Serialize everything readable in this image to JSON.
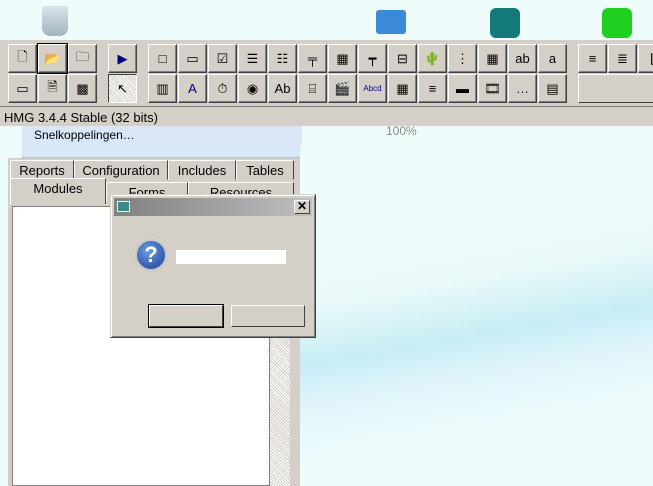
{
  "desktop": {
    "icons": [
      "recycle-bin-icon",
      "control-panel-icon",
      "shortcut-teal-cube-icon",
      "shortcut-green-cube-icon"
    ]
  },
  "toolbar": {
    "row1": [
      {
        "icon": "new-file-icon",
        "glyph": "🗋"
      },
      {
        "icon": "open-folder-icon",
        "glyph": "📂",
        "active": true
      },
      {
        "icon": "open-project-icon",
        "glyph": "🗀"
      },
      {
        "icon": "run-icon",
        "glyph": "▶"
      },
      {
        "icon": "frame-icon",
        "glyph": "□"
      },
      {
        "icon": "button-control-icon",
        "glyph": "▭"
      },
      {
        "icon": "checkbox-icon",
        "glyph": "☑"
      },
      {
        "icon": "listbox-icon",
        "glyph": "☰"
      },
      {
        "icon": "combobox-icon",
        "glyph": "☷"
      },
      {
        "icon": "splitter-icon",
        "glyph": "╤"
      },
      {
        "icon": "grid-icon",
        "glyph": "▦"
      },
      {
        "icon": "slider-icon",
        "glyph": "┯"
      },
      {
        "icon": "spinner-icon",
        "glyph": "⊟"
      },
      {
        "icon": "image-icon",
        "glyph": "🌵"
      },
      {
        "icon": "tree-icon",
        "glyph": "⋮"
      },
      {
        "icon": "datepicker-icon",
        "glyph": "▦"
      },
      {
        "icon": "textbox-icon",
        "glyph": "ab"
      },
      {
        "icon": "editbox-icon",
        "glyph": "a"
      },
      {
        "icon": "toolbar-control-icon",
        "glyph": "≡"
      },
      {
        "icon": "statusbar-icon",
        "glyph": "≣"
      },
      {
        "icon": "chart-icon",
        "glyph": "⌊"
      }
    ],
    "row2": [
      {
        "icon": "form-icon",
        "glyph": "▭"
      },
      {
        "icon": "document-icon",
        "glyph": "🗎"
      },
      {
        "icon": "texture-icon",
        "glyph": "▩"
      },
      {
        "icon": "pointer-icon",
        "glyph": "↖",
        "pressed": true
      },
      {
        "icon": "activex-icon",
        "glyph": "▥"
      },
      {
        "icon": "label-icon",
        "glyph": "A"
      },
      {
        "icon": "timer-icon",
        "glyph": "⏱"
      },
      {
        "icon": "radio-icon",
        "glyph": "◉"
      },
      {
        "icon": "hyperlink-frame-icon",
        "glyph": "Ab"
      },
      {
        "icon": "tab-control-icon",
        "glyph": "⌸"
      },
      {
        "icon": "animate-icon",
        "glyph": "🎬"
      },
      {
        "icon": "hyperlink-icon",
        "glyph": "Abcd"
      },
      {
        "icon": "monthcal-icon",
        "glyph": "▦"
      },
      {
        "icon": "richedit-icon",
        "glyph": "≡"
      },
      {
        "icon": "progressbar-icon",
        "glyph": "▬"
      },
      {
        "icon": "player-icon",
        "glyph": "🎞"
      },
      {
        "icon": "ipaddress-icon",
        "glyph": "…"
      },
      {
        "icon": "browse-icon",
        "glyph": "▤"
      }
    ]
  },
  "status": {
    "text": "HMG 3.4.4 Stable (32 bits)"
  },
  "explorer": {
    "shortcut": "Snelkoppelingen…",
    "zoom": "100%"
  },
  "tabs": {
    "row1": [
      "Reports",
      "Configuration",
      "Includes",
      "Tables"
    ],
    "row2": [
      "Modules",
      "Forms",
      "Resources"
    ],
    "selected": "Modules"
  },
  "dialog": {
    "title": "",
    "icon": "question-icon",
    "message": "",
    "close": "✕",
    "buttons": [
      "",
      ""
    ]
  }
}
